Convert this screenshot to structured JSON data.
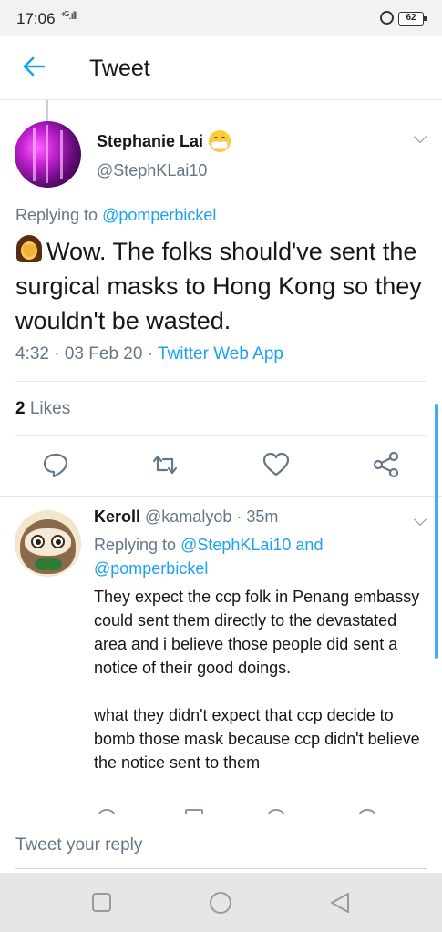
{
  "status_bar": {
    "time": "17:06",
    "network": "⁴ᴳ.ıll",
    "battery": "62"
  },
  "header": {
    "title": "Tweet"
  },
  "tweet": {
    "author_name": "Stephanie Lai",
    "author_handle": "@StephKLai10",
    "replying_prefix": "Replying to ",
    "replying_to": "@pomperbickel",
    "text": "Wow. The folks should've sent the surgical masks to Hong Kong so they wouldn't be wasted.",
    "time_date": "4:32 · 03 Feb 20 · ",
    "source": "Twitter Web App",
    "likes_count": "2",
    "likes_label": " Likes"
  },
  "reply": {
    "author_name": "Keroll",
    "author_handle": "@kamalyob",
    "age": " · 35m",
    "replying_prefix": "Replying to ",
    "replying_to_1": "@StephKLai10",
    "replying_and": " and",
    "replying_to_2": "@pomperbickel",
    "text_paragraph_1": "They expect the ccp folk in Penang embassy could sent them directly to the devastated area and i believe those people did sent a notice of their good doings.",
    "text_paragraph_2": "what they didn't expect that ccp decide to bomb those mask because ccp didn't believe the notice sent to them"
  },
  "composer": {
    "placeholder": "Tweet your reply"
  },
  "colors": {
    "accent": "#1da1f2",
    "secondary_text": "#657786",
    "divider": "#e1e8ed"
  },
  "icons": {
    "back": "arrow-left-icon",
    "reply": "reply-icon",
    "retweet": "retweet-icon",
    "like": "heart-icon",
    "share": "share-icon"
  }
}
